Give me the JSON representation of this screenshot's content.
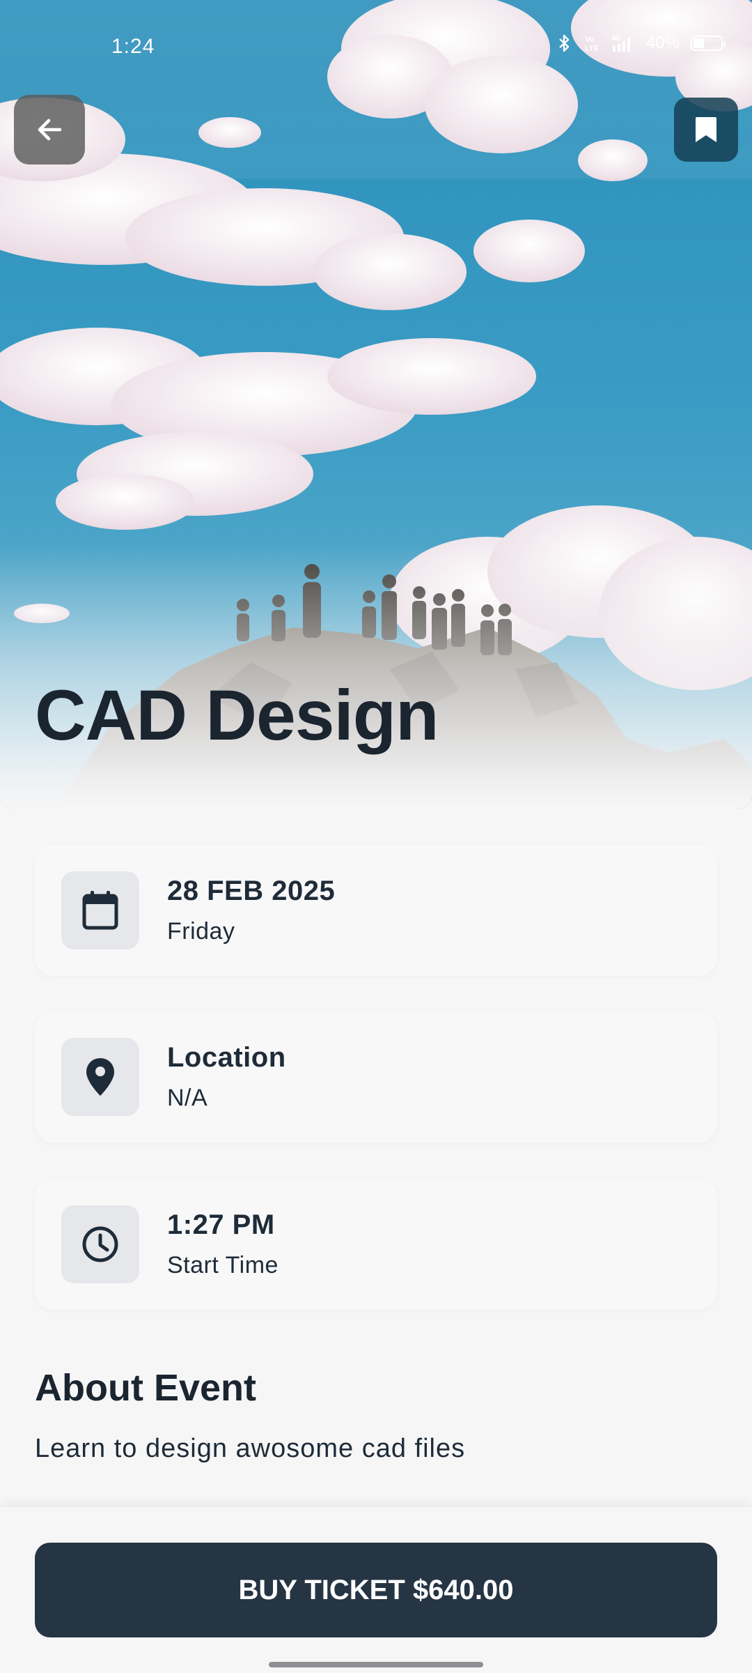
{
  "status_bar": {
    "time": "1:24",
    "battery_percent": "40%",
    "battery_level": 0.4,
    "icons": [
      "bluetooth-icon",
      "volte-icon",
      "signal-4g-icon",
      "battery-icon"
    ]
  },
  "header": {
    "back_icon": "arrow-left-icon",
    "bookmark_icon": "bookmark-icon"
  },
  "event": {
    "title": "CAD Design"
  },
  "details": {
    "date": {
      "icon": "calendar-icon",
      "primary": "28 FEB 2025",
      "secondary": "Friday"
    },
    "location": {
      "icon": "location-pin-icon",
      "primary": "Location",
      "secondary": "N/A"
    },
    "time": {
      "icon": "clock-icon",
      "primary": "1:27 PM",
      "secondary": "Start Time"
    }
  },
  "about": {
    "heading": "About Event",
    "description": "Learn to design awosome cad files"
  },
  "actions": {
    "buy_label": "BUY TICKET $640.00"
  },
  "colors": {
    "primary_dark": "#253544",
    "text": "#1e2b38",
    "background": "#f6f6f7",
    "icon_box": "#e5e7ea",
    "sky": "#2f8fb8"
  }
}
